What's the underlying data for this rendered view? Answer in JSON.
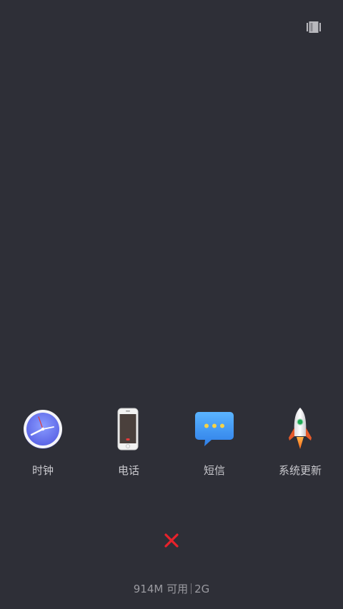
{
  "top_action": {
    "icon": "layout-toggle-icon"
  },
  "apps": [
    {
      "label": "时钟",
      "icon": "clock-icon"
    },
    {
      "label": "电话",
      "icon": "phone-icon"
    },
    {
      "label": "短信",
      "icon": "message-icon"
    },
    {
      "label": "系统更新",
      "icon": "rocket-icon"
    }
  ],
  "close": {
    "icon": "close-icon",
    "color": "#e8222b"
  },
  "memory": {
    "available": "914M 可用",
    "total": "2G"
  },
  "colors": {
    "background": "#2e2f37",
    "label": "#c9c9ce"
  }
}
